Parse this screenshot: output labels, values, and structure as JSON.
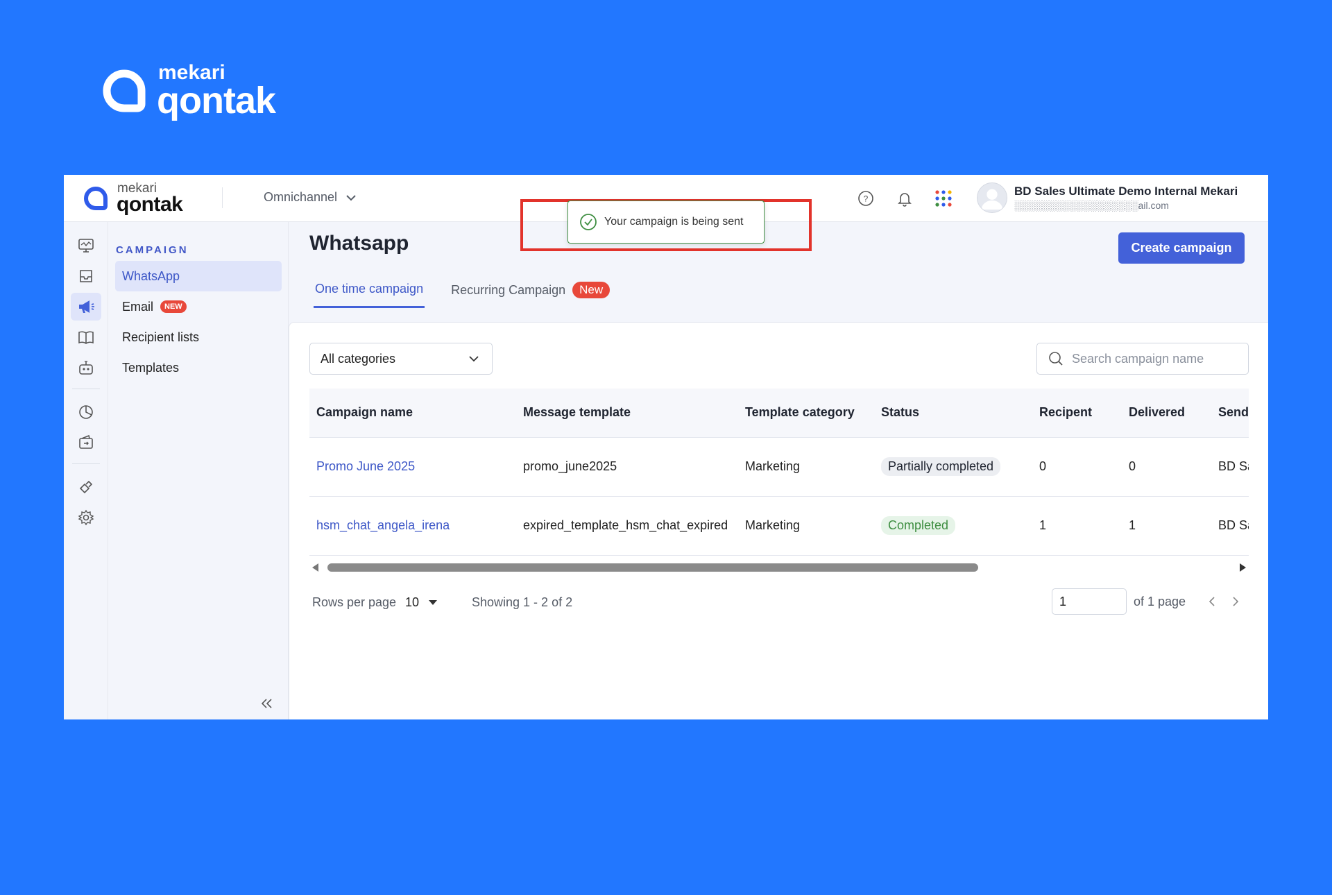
{
  "brand": {
    "small": "mekari",
    "big": "qontak"
  },
  "topbar": {
    "product": "Omnichannel",
    "user_name": "BD Sales Ultimate Demo Internal Mekari",
    "user_email": "░░░░░░░░░░░░░░░░░░ail.com"
  },
  "toast": {
    "message": "Your campaign is being sent"
  },
  "sidebar": {
    "heading": "CAMPAIGN",
    "items": [
      {
        "label": "WhatsApp"
      },
      {
        "label": "Email",
        "badge": "NEW"
      },
      {
        "label": "Recipient lists"
      },
      {
        "label": "Templates"
      }
    ]
  },
  "main": {
    "title": "Whatsapp",
    "create_button": "Create campaign",
    "tabs": [
      {
        "label": "One time campaign"
      },
      {
        "label": "Recurring Campaign",
        "badge": "New"
      }
    ],
    "category_select": "All categories",
    "search_placeholder": "Search campaign name"
  },
  "table": {
    "columns": [
      "Campaign name",
      "Message template",
      "Template category",
      "Status",
      "Recipent",
      "Delivered",
      "Sender"
    ],
    "rows": [
      [
        "Promo June 2025",
        "promo_june2025",
        "Marketing",
        "Partially completed",
        "0",
        "0",
        "BD Sales"
      ],
      [
        "hsm_chat_angela_irena",
        "expired_template_hsm_chat_expired",
        "Marketing",
        "Completed",
        "1",
        "1",
        "BD Sales"
      ]
    ]
  },
  "pagination": {
    "rows_label": "Rows per page",
    "rows_value": "10",
    "showing": "Showing 1 - 2 of 2",
    "page": "1",
    "of_label": "of 1 page"
  },
  "colors": {
    "brand_blue": "#2277ff",
    "primary": "#4361d9",
    "success": "#3e8e41",
    "danger": "#e8483a"
  }
}
